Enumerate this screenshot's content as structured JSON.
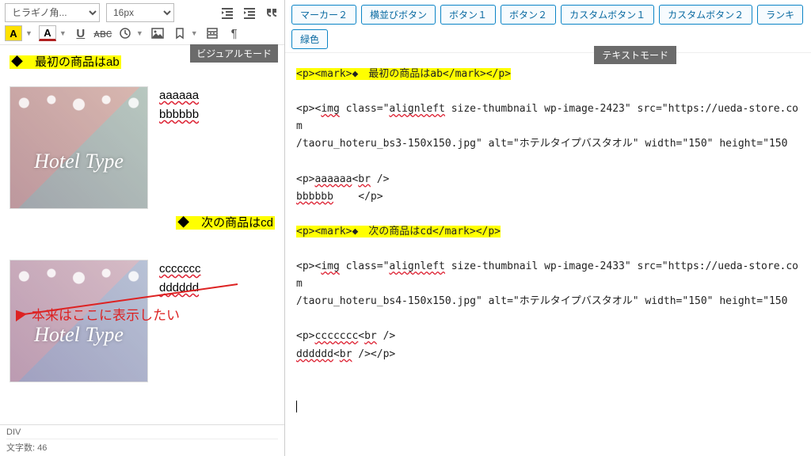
{
  "toolbar": {
    "font": "ヒラギノ角...",
    "size": "16px"
  },
  "modes": {
    "visual": "ビジュアルモード",
    "text": "テキストモード"
  },
  "buttons": {
    "marker2": "マーカー２",
    "inline_btn": "横並びボタン",
    "btn1": "ボタン１",
    "btn2": "ボタン２",
    "custom1": "カスタムボタン１",
    "custom2": "カスタムボタン２",
    "rank": "ランキ",
    "green": "緑色"
  },
  "visual": {
    "mark1_a": "◆　最初の商品はab",
    "para1_a": "aaaaaa",
    "para1_b": "bbbbbb",
    "mark2_a": "◆　次の商品はcd",
    "para2_a": "ccccccc",
    "para2_b": "dddddd",
    "thumb_text": "Hotel Type"
  },
  "annotation": "本来はここに表示したい",
  "status": {
    "path": "DIV",
    "wc_label": "文字数:",
    "wc_value": "46"
  },
  "code": {
    "l1": "<p><mark>◆　最初の商品はab</mark></p>",
    "l2a": "<p><",
    "l2_img": "img",
    "l2b": " class=\"",
    "l2_align": "alignleft",
    "l2c": " size-thumbnail wp-image-2423\" src=\"https://ueda-store.com",
    "l3a": "/taoru_hoteru_bs3-150x150.jpg\" alt=\"ホテルタイプバスタオル\" width=\"150\" height=\"150",
    "l4a": "<p>",
    "l4_aa": "aaaaaa",
    "l4b": "<",
    "l4_br": "br",
    "l4c": " />",
    "l5_bb": "bbbbbb",
    "l5a": "    </p>",
    "l6": "<p><mark>◆　次の商品はcd</mark></p>",
    "l7a": "<p><",
    "l7_img": "img",
    "l7b": " class=\"",
    "l7_align": "alignleft",
    "l7c": " size-thumbnail wp-image-2433\" src=\"https://ueda-store.com",
    "l8a": "/taoru_hoteru_bs4-150x150.jpg\" alt=\"ホテルタイプバスタオル\" width=\"150\" height=\"150",
    "l9a": "<p>",
    "l9_cc": "ccccccc",
    "l9b": "<",
    "l9_br": "br",
    "l9c": " />",
    "l10_dd": "dddddd",
    "l10a": "<",
    "l10_br": "br",
    "l10b": " /></p>"
  }
}
